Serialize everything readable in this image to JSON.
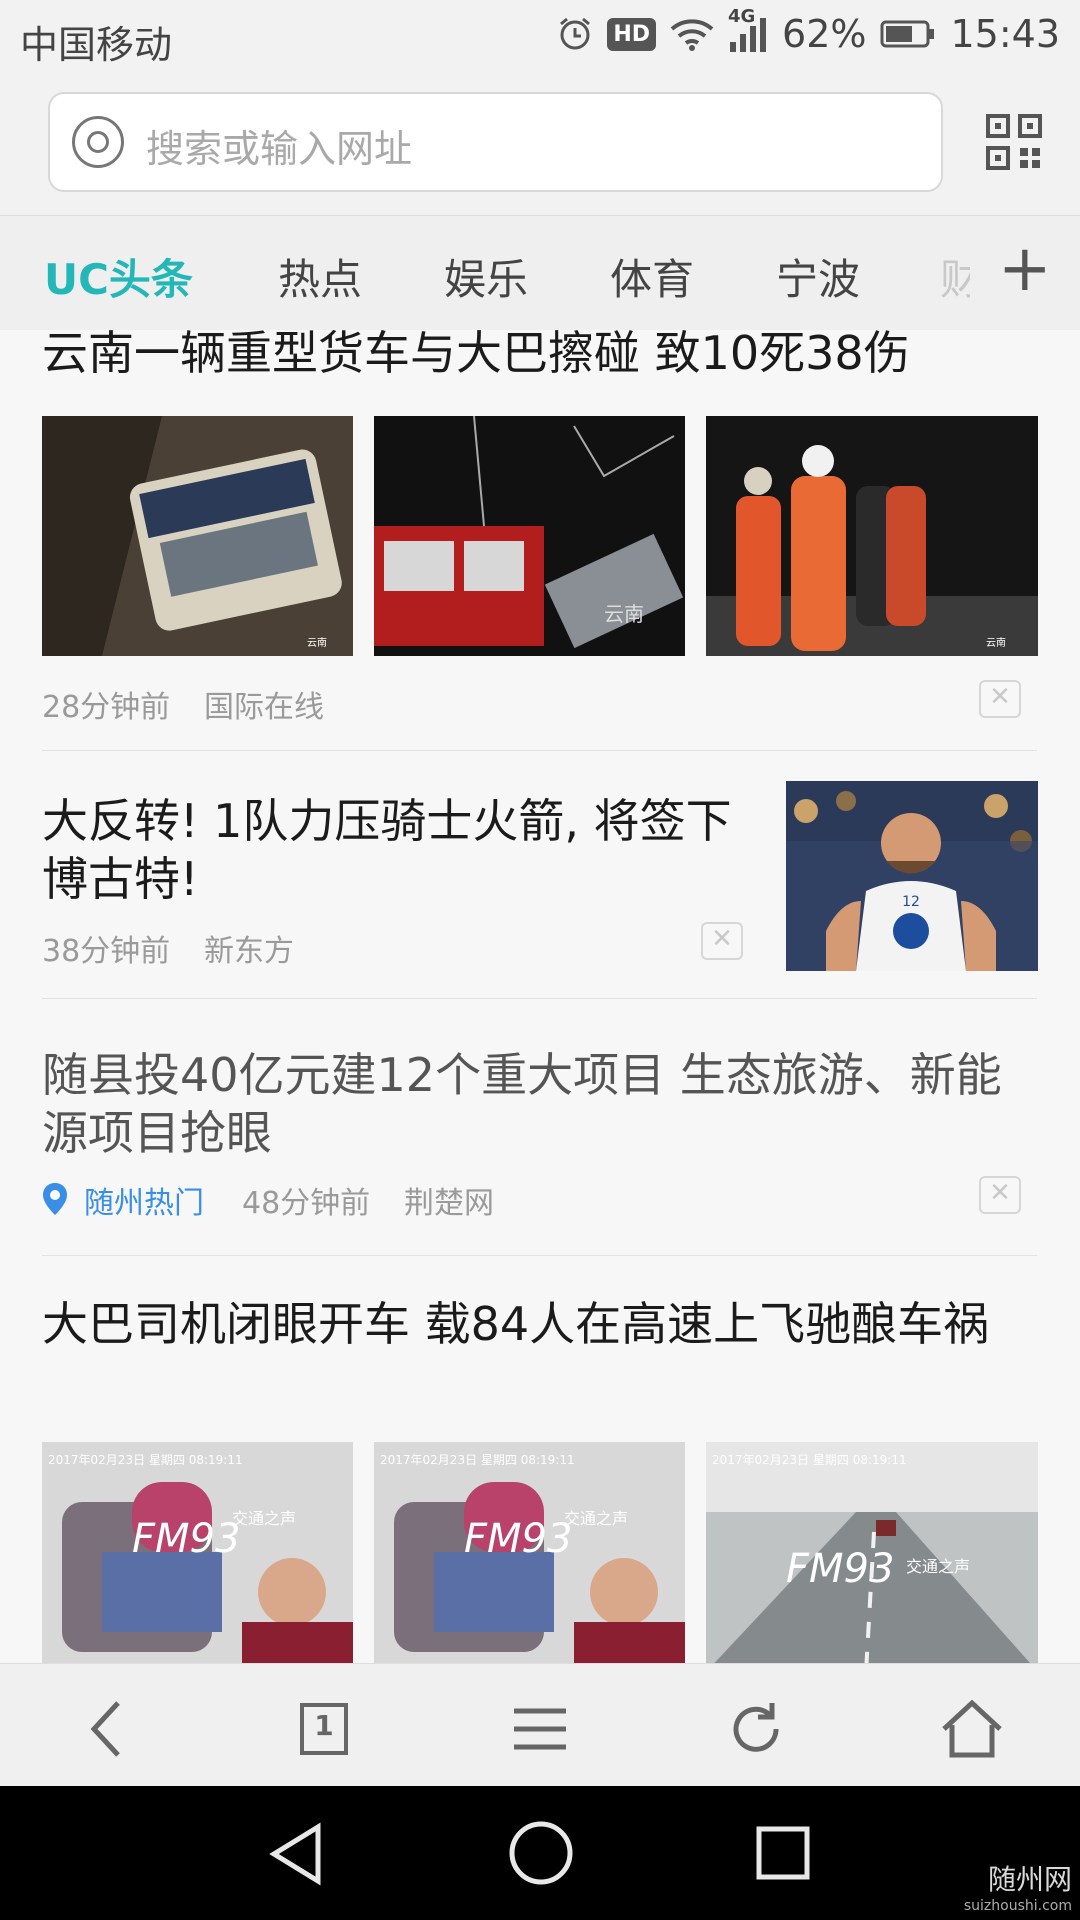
{
  "status": {
    "carrier": "中国移动",
    "hd": "HD",
    "network": "4G",
    "battery": "62%",
    "time": "15:43"
  },
  "search": {
    "placeholder": "搜索或输入网址"
  },
  "tabs": [
    "UC头条",
    "热点",
    "娱乐",
    "体育",
    "宁波",
    "财"
  ],
  "feed": [
    {
      "title": "云南一辆重型货车与大巴擦碰 致10死38伤",
      "time": "28分钟前",
      "source": "国际在线",
      "image_watermarks": [
        "云南",
        "云南",
        "云南"
      ]
    },
    {
      "title": "大反转! 1队力压骑士火箭, 将签下博古特!",
      "time": "38分钟前",
      "source": "新东方",
      "jersey": "12"
    },
    {
      "title": "随县投40亿元建12个重大项目 生态旅游、新能源项目抢眼",
      "location": "随州热门",
      "time": "48分钟前",
      "source": "荆楚网"
    },
    {
      "title": "大巴司机闭眼开车 载84人在高速上飞驰酿车祸",
      "image_text": [
        "2017年02月23日 星期四 08:19:11",
        "FM93",
        "交通之声"
      ]
    }
  ],
  "toolbar": {
    "tab_count": "1"
  },
  "watermark": {
    "name": "随州网",
    "url": "suizhoushi.com"
  },
  "colors": {
    "accent": "#23b8b7",
    "location": "#3a8ee6"
  }
}
